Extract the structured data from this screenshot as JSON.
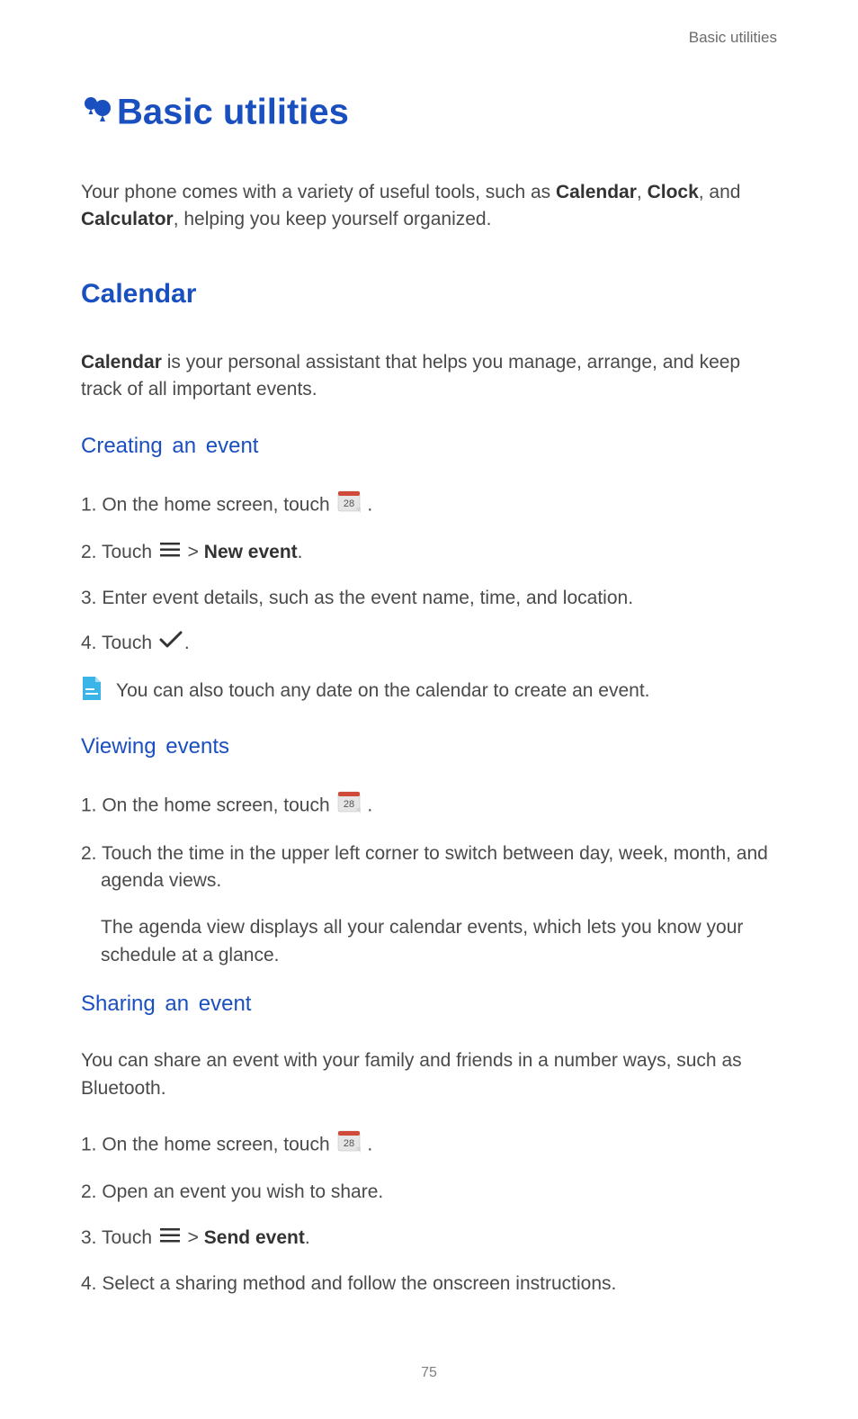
{
  "header": {
    "running_title": "Basic utilities"
  },
  "title": "Basic utilities",
  "intro_pre": "Your phone comes with a variety of useful tools, such as ",
  "intro_b1": "Calendar",
  "intro_sep1": ", ",
  "intro_b2": "Clock",
  "intro_sep2": ", and ",
  "intro_b3": "Calculator",
  "intro_post": ", helping you keep yourself organized.",
  "section1": {
    "title": "Calendar",
    "intro_b": "Calendar",
    "intro_rest": " is your personal assistant that helps you manage, arrange, and keep track of all important events.",
    "sub1": {
      "title": "Creating an event",
      "s1_pre": "1. On the home screen, touch ",
      "s1_post": " .",
      "s2_pre": "2. Touch ",
      "s2_mid": "  > ",
      "s2_bold": "New event",
      "s2_post": ".",
      "s3": "3. Enter event details, such as the event name, time, and location.",
      "s4_pre": "4. Touch ",
      "s4_post": ".",
      "note": "You can also touch any date on the calendar to create an event."
    },
    "sub2": {
      "title": "Viewing events",
      "s1_pre": "1. On the home screen, touch ",
      "s1_post": " .",
      "s2": "2. Touch the time in the upper left corner to switch between day, week, month, and agenda views.",
      "s2b": "The agenda view displays all your calendar events, which lets you know your schedule at a glance."
    },
    "sub3": {
      "title": "Sharing an event",
      "intro": "You can share an event with your family and friends in a number ways, such as Bluetooth.",
      "s1_pre": "1. On the home screen, touch ",
      "s1_post": " .",
      "s2": "2. Open an event you wish to share.",
      "s3_pre": "3. Touch ",
      "s3_mid": "  > ",
      "s3_bold": "Send event",
      "s3_post": ".",
      "s4": "4. Select a sharing method and follow the onscreen instructions."
    }
  },
  "icons": {
    "calendar_day": "28"
  },
  "page_number": "75"
}
